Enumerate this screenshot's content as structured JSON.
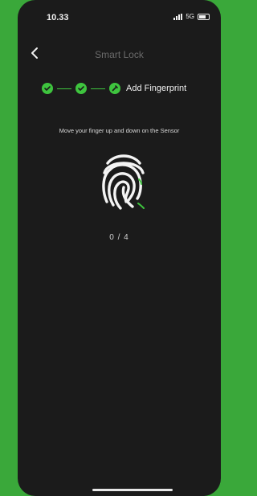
{
  "status": {
    "time": "10.33",
    "network": "5G"
  },
  "header": {
    "title": "Smart Lock"
  },
  "steps": {
    "label": "Add Fingerprint"
  },
  "instruction": "Move your finger up and down on the Sensor",
  "progress": {
    "text": "0 / 4",
    "current": 0,
    "total": 4
  },
  "colors": {
    "accent": "#3ec43e",
    "background": "#1b1b1b",
    "frame": "#3aa83a"
  },
  "icons": [
    "back-chevron-icon",
    "check-icon",
    "pencil-icon",
    "fingerprint-icon",
    "signal-icon",
    "battery-icon"
  ]
}
